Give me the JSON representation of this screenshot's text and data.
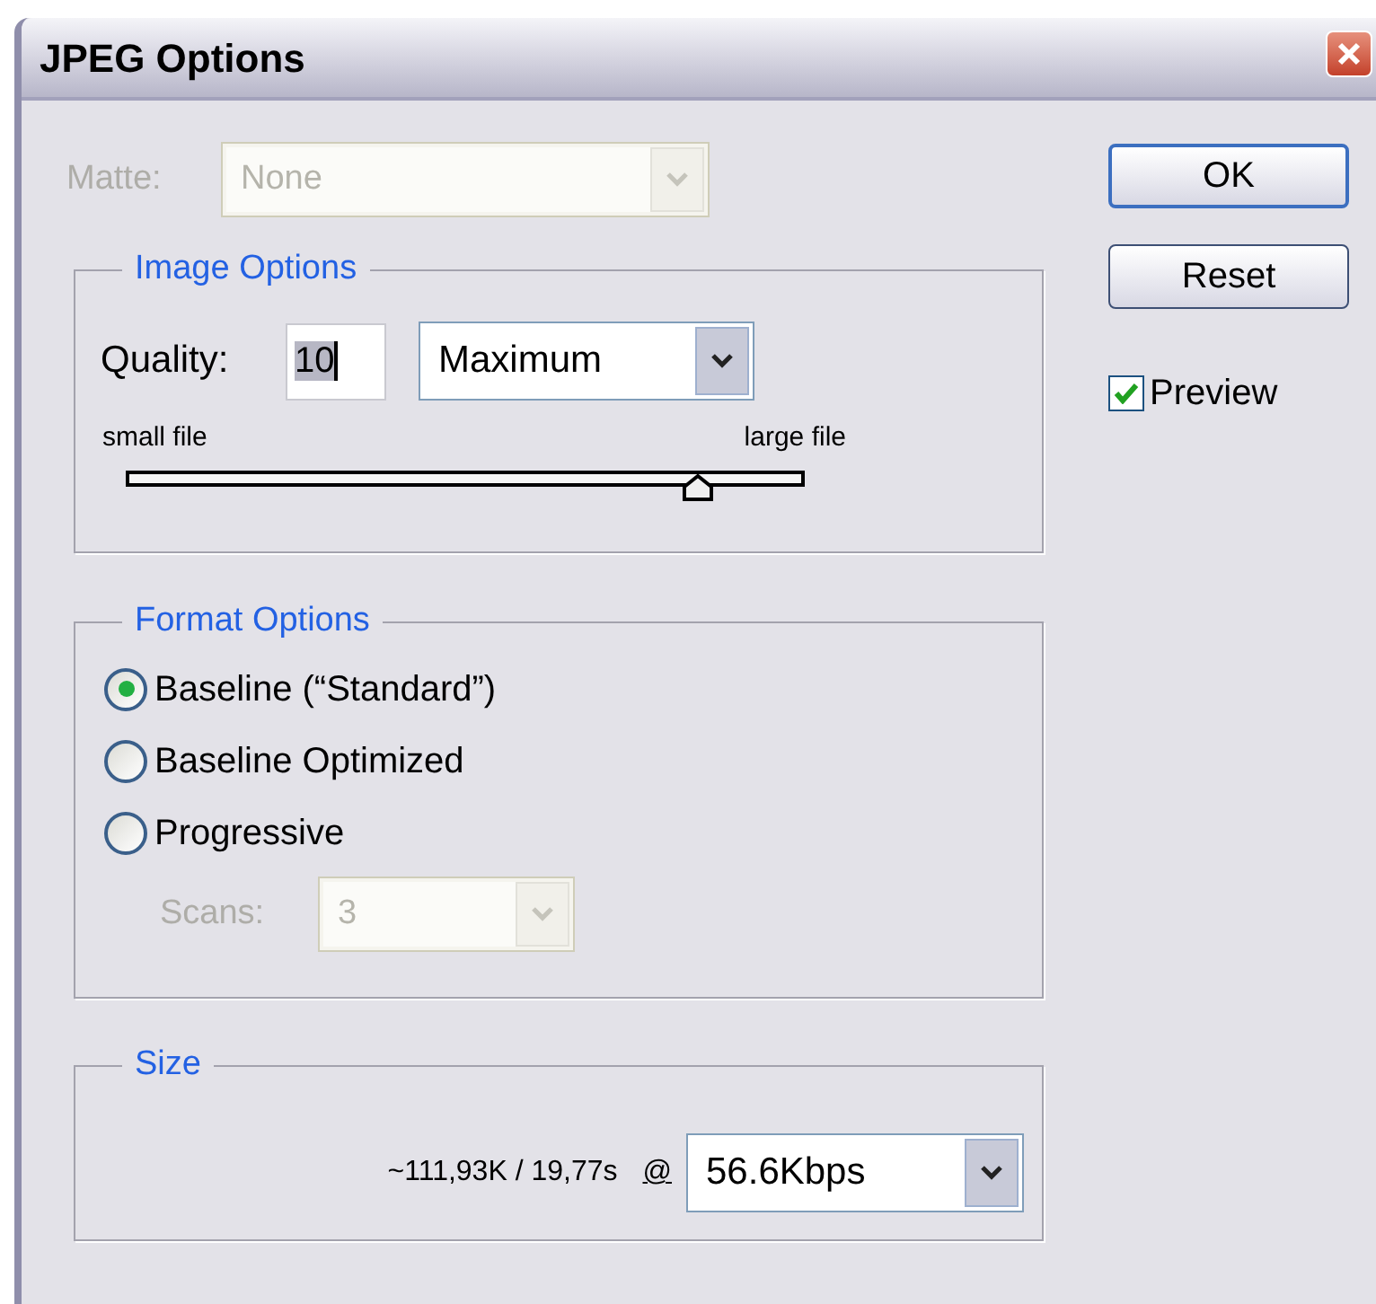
{
  "window": {
    "title": "JPEG Options"
  },
  "matte": {
    "label": "Matte:",
    "value": "None",
    "disabled": true
  },
  "buttons": [
    {
      "label": "OK",
      "default": true
    },
    {
      "label": "Reset",
      "default": false
    }
  ],
  "preview": {
    "label": "Preview",
    "checked": true
  },
  "image_options": {
    "title": "Image Options",
    "quality_label": "Quality:",
    "quality_value": "10",
    "quality_preset": "Maximum",
    "slider": {
      "min_label": "small file",
      "max_label": "large file",
      "level": 0.84
    }
  },
  "format_options": {
    "title": "Format Options",
    "radios": [
      {
        "label": "Baseline (“Standard”)",
        "selected": true
      },
      {
        "label": "Baseline Optimized",
        "selected": false
      },
      {
        "label": "Progressive",
        "selected": false
      }
    ],
    "scans": {
      "label": "Scans:",
      "value": "3",
      "disabled": true
    }
  },
  "size": {
    "title": "Size",
    "estimate": "~111,93K / 19,77s",
    "at": "@",
    "speed": "56.6Kbps"
  }
}
